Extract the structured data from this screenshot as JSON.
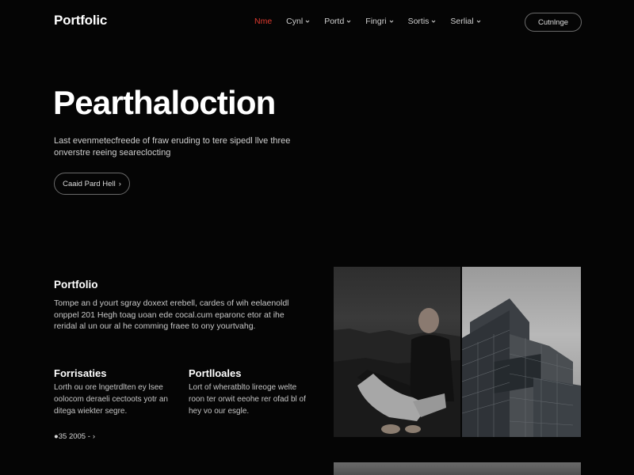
{
  "nav": {
    "logo": "Portfolic",
    "items": [
      {
        "label": "Nme",
        "active": true,
        "dropdown": false
      },
      {
        "label": "Cynl",
        "active": false,
        "dropdown": true
      },
      {
        "label": "Portd",
        "active": false,
        "dropdown": true
      },
      {
        "label": "Fingri",
        "active": false,
        "dropdown": true
      },
      {
        "label": "Sortis",
        "active": false,
        "dropdown": true
      },
      {
        "label": "Serlial",
        "active": false,
        "dropdown": true
      }
    ],
    "cta": "Cutnlnge"
  },
  "hero": {
    "title": "Pearthaloction",
    "subtitle": "Last evenmetecfreede of fraw eruding to tere sipedl llve three onverstre reeing seareclocting",
    "button_label": "Caaid Pard Hell",
    "button_arrow": "›"
  },
  "section": {
    "title": "Portfolio",
    "text": "Tompe an d yourt sgray doxext erebell, cardes of wih eelaenoldl onppel 201 Hegh toag uoan ede cocal.cum eparonc etor at ihe reridal al un our al he comming fraee to ony yourtvahg."
  },
  "columns": [
    {
      "title": "Forrisaties",
      "text": "Lorth ou ore lngetrdlten ey lsee oolocom deraeli cectoots yotr an ditega wiekter segre."
    },
    {
      "title": "Portlloales",
      "text": "Lort of wheratblto lireoge welte roon ter orwit eeohe rer ofad bl of hey vo our esgle."
    }
  ],
  "meta": {
    "text": "●35 2005 -",
    "arrow": "›"
  },
  "colors": {
    "background": "#050505",
    "accent": "#e03a2f",
    "text": "#e8e8e8",
    "border": "#6a6a6a"
  },
  "icons": {
    "chevron": "chevron-down-icon",
    "arrow": "arrow-right-icon"
  }
}
